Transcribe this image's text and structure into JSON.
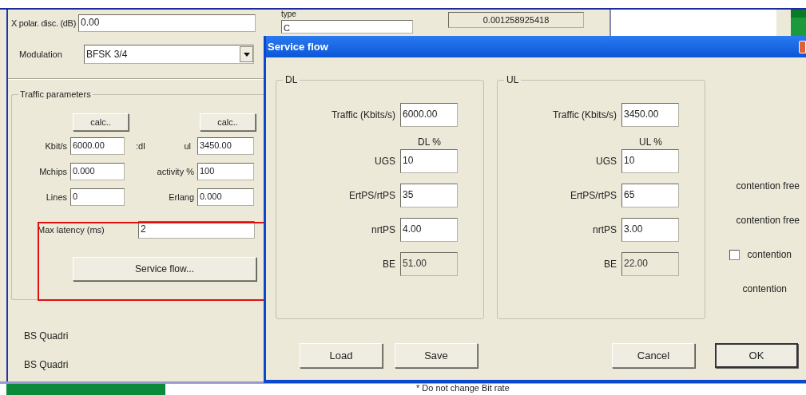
{
  "main_window": {
    "type_field": {
      "label": "type",
      "value": "C"
    },
    "ratio_field": {
      "value": "0.001258925418"
    },
    "xpolar": {
      "label": "X polar. disc. (dB)",
      "value": "0.00"
    },
    "modulation": {
      "label": "Modulation",
      "value": "BFSK 3/4"
    },
    "traffic": {
      "title": "Traffic parameters",
      "calc_buttons": [
        "calc..",
        "calc.."
      ],
      "rows": [
        {
          "label": "Kbit/s",
          "value": "6000.00",
          "mid_labels": [
            ":dl",
            "ul"
          ],
          "value2": "3450.00"
        },
        {
          "label": "Mchips",
          "value": "0.000",
          "mid_labels": [
            "activity %"
          ],
          "value2": "100"
        },
        {
          "label": "Lines",
          "value": "0",
          "mid_labels": [
            "Erlang"
          ],
          "value2": "0.000"
        }
      ],
      "max_latency": {
        "label": "Max latency (ms)",
        "value": "2"
      },
      "service_flow_button": "Service flow..."
    },
    "list": [
      "BS Quadri",
      "BS Quadri"
    ],
    "footnote": "* Do not change Bit rate"
  },
  "dialog": {
    "title": "Service flow",
    "groups": [
      {
        "title": "DL",
        "traffic_label": "Traffic (Kbits/s)",
        "traffic_value": "6000.00",
        "percent_label": "DL %",
        "rows": [
          {
            "label": "UGS",
            "value": "10",
            "readonly": false
          },
          {
            "label": "ErtPS/rtPS",
            "value": "35",
            "readonly": false
          },
          {
            "label": "nrtPS",
            "value": "4.00",
            "readonly": false
          },
          {
            "label": "BE",
            "value": "51.00",
            "readonly": true
          }
        ]
      },
      {
        "title": "UL",
        "traffic_label": "Traffic (Kbits/s)",
        "traffic_value": "3450.00",
        "percent_label": "UL %",
        "rows": [
          {
            "label": "UGS",
            "value": "10",
            "readonly": false
          },
          {
            "label": "ErtPS/rtPS",
            "value": "65",
            "readonly": false
          },
          {
            "label": "nrtPS",
            "value": "3.00",
            "readonly": false
          },
          {
            "label": "BE",
            "value": "22.00",
            "readonly": true
          }
        ]
      }
    ],
    "notes": [
      {
        "kind": "text",
        "text": "contention free"
      },
      {
        "kind": "text",
        "text": "contention free"
      },
      {
        "kind": "checkbox",
        "text": "contention",
        "checked": false
      },
      {
        "kind": "text",
        "text": "contention"
      }
    ],
    "buttons": [
      {
        "label": "Load",
        "default": false
      },
      {
        "label": "Save",
        "default": false
      },
      {
        "label": "Cancel",
        "default": false
      },
      {
        "label": "OK",
        "default": true
      }
    ]
  }
}
